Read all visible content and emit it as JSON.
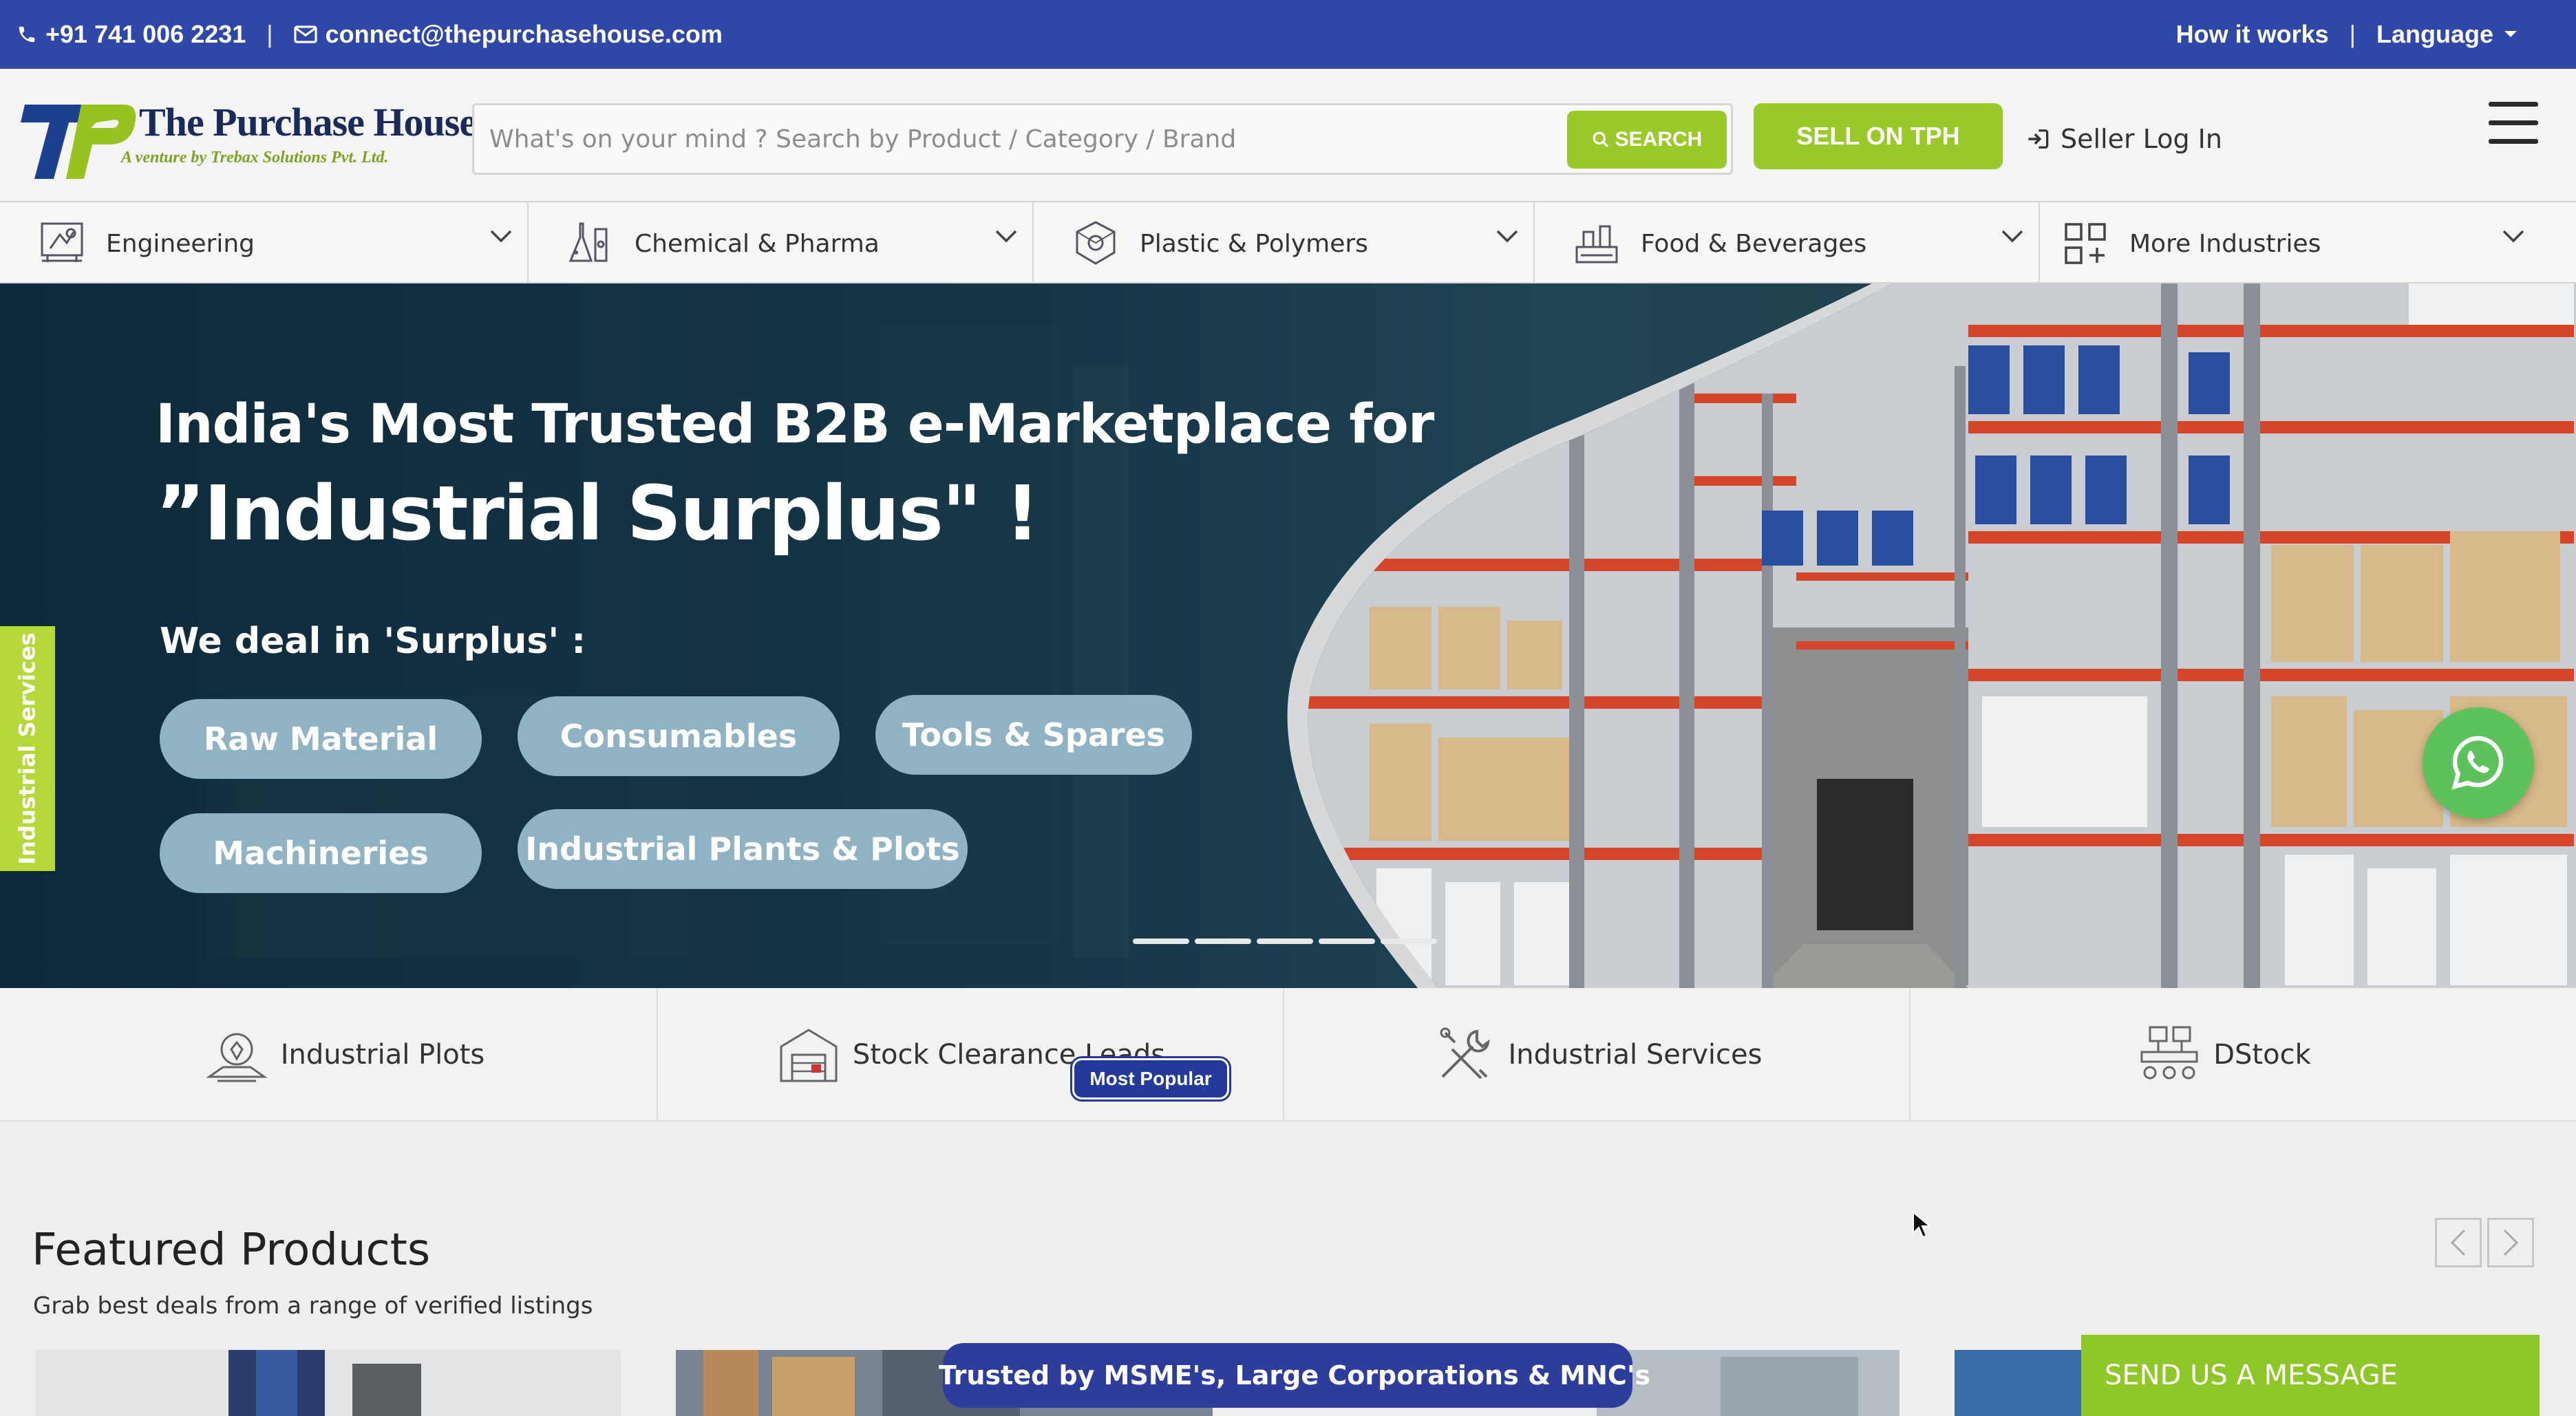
{
  "topbar": {
    "phone": "+91 741 006 2231",
    "separator": "|",
    "email": "connect@thepurchasehouse.com",
    "how_it_works": "How it works",
    "language": "Language"
  },
  "header": {
    "logo_letters": "TP",
    "logo_title": "The Purchase House",
    "logo_subtitle": "A venture by Trebax Solutions Pvt. Ltd.",
    "search_placeholder": "What's on your mind ? Search by Product / Category / Brand",
    "search_button": "SEARCH",
    "sell_button": "SELL ON TPH",
    "seller_login": "Seller Log In"
  },
  "categories": [
    {
      "label": "Engineering",
      "icon": "engineering-icon"
    },
    {
      "label": "Chemical & Pharma",
      "icon": "chemical-pharma-icon"
    },
    {
      "label": "Plastic & Polymers",
      "icon": "plastic-polymers-icon"
    },
    {
      "label": "Food & Beverages",
      "icon": "food-beverages-icon"
    },
    {
      "label": "More Industries",
      "icon": "grid-plus-icon"
    }
  ],
  "hero": {
    "title_line1": "India's Most Trusted B2B e-Marketplace for",
    "title_line2": "”Industrial Surplus\" !",
    "subtitle": "We deal in 'Surplus' :",
    "pills": [
      "Raw Material",
      "Consumables",
      "Tools & Spares",
      "Machineries",
      "Industrial Plants & Plots"
    ],
    "slides_total": 5
  },
  "side_tab": "Industrial Services",
  "services": [
    {
      "label": "Industrial Plots",
      "icon": "plot-icon"
    },
    {
      "label": "Stock Clearance Leads",
      "icon": "warehouse-icon"
    },
    {
      "label": "Industrial Services",
      "icon": "tools-icon"
    },
    {
      "label": "DStock",
      "icon": "conveyor-icon"
    }
  ],
  "badge": "Most Popular",
  "featured": {
    "title": "Featured Products",
    "subtitle": "Grab best deals from a range of verified listings"
  },
  "trusted": "Trusted by MSME's, Large Corporations & MNC's",
  "send_message": "SEND US A MESSAGE",
  "colors": {
    "topbar": "#2f47a6",
    "accent_green": "#9ac92a",
    "badge_blue": "#233a9a",
    "pill": "#8fb3c2",
    "whatsapp": "#5dc25b"
  }
}
